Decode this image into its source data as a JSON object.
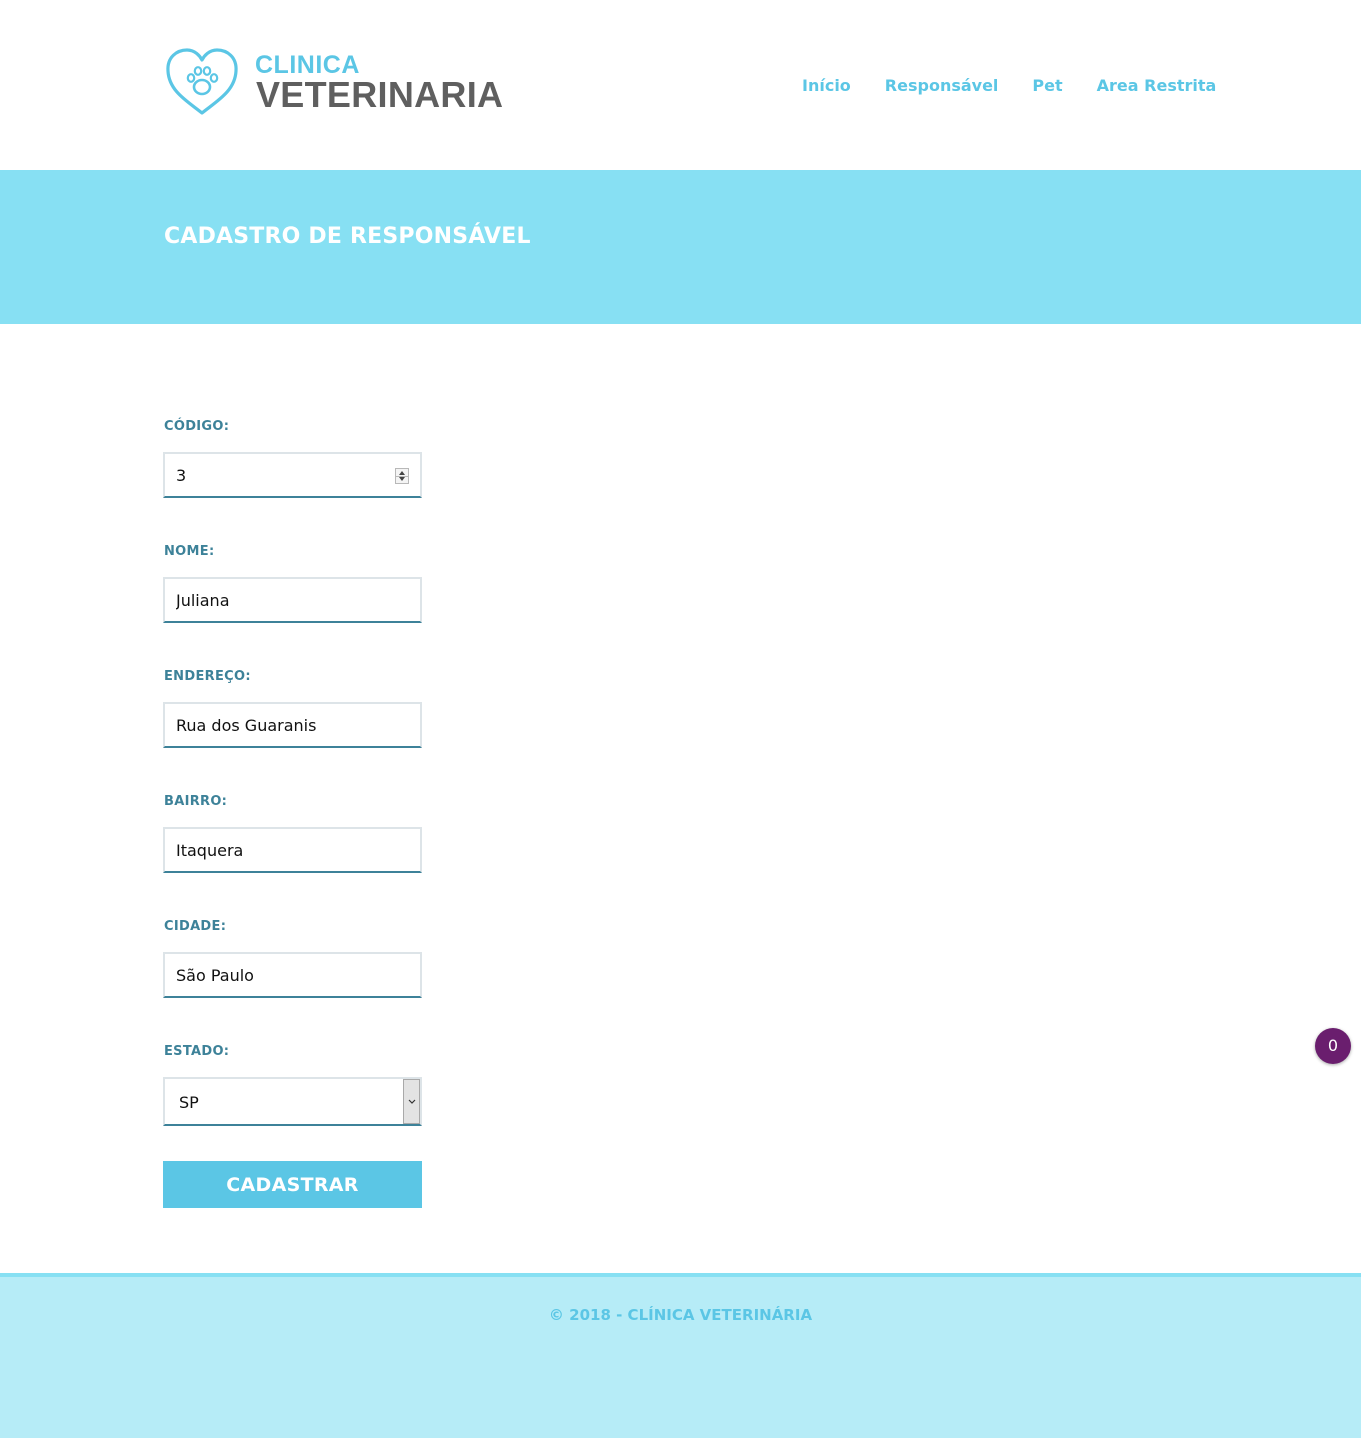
{
  "brand": {
    "line1": "CLINICA",
    "line2": "VETERINARIA",
    "icon": "heart-paw-icon",
    "accent_color": "#5bc6e5",
    "dark_color": "#5f5f5f"
  },
  "nav": {
    "items": [
      {
        "label": "Início"
      },
      {
        "label": "Responsável"
      },
      {
        "label": "Pet"
      },
      {
        "label": "Area Restrita"
      }
    ]
  },
  "banner": {
    "title": "CADASTRO DE RESPONSÁVEL",
    "color": "#87e0f3"
  },
  "form": {
    "codigo": {
      "label": "CÓDIGO:",
      "value": "3"
    },
    "nome": {
      "label": "NOME:",
      "value": "Juliana"
    },
    "endereco": {
      "label": "ENDEREÇO:",
      "value": "Rua dos Guaranis"
    },
    "bairro": {
      "label": "BAIRRO:",
      "value": "Itaquera"
    },
    "cidade": {
      "label": "CIDADE:",
      "value": "São Paulo"
    },
    "estado": {
      "label": "ESTADO:",
      "value": "SP"
    },
    "submit_label": "CADASTRAR",
    "label_color": "#3d8299"
  },
  "badge": {
    "count": "0",
    "color": "#6a1e6e"
  },
  "footer": {
    "text": "© 2018 - CLÍNICA VETERINÁRIA",
    "color": "#b6ecf7"
  }
}
